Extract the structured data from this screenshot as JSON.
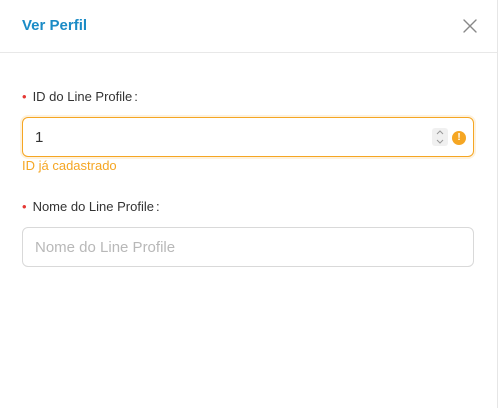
{
  "modal": {
    "title": "Ver Perfil",
    "close_icon": "close-icon"
  },
  "form": {
    "line_profile_id": {
      "label": "ID do Line Profile",
      "label_suffix": ":",
      "required_mark": "•",
      "value": "1",
      "status": "warning",
      "warning_icon": "!",
      "helper_text": "ID já cadastrado"
    },
    "line_profile_name": {
      "label": "Nome do Line Profile",
      "label_suffix": ":",
      "required_mark": "•",
      "value": "",
      "placeholder": "Nome do Line Profile"
    }
  },
  "colors": {
    "title": "#1a8bc6",
    "required": "#e53935",
    "warning": "#f5a623",
    "border": "#d9d9d9"
  }
}
